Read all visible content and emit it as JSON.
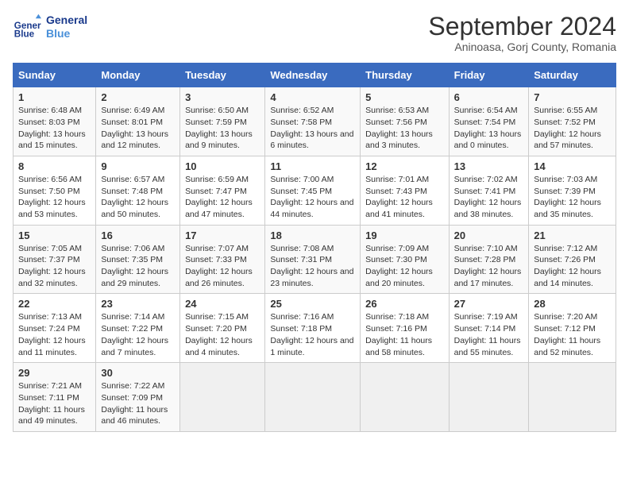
{
  "header": {
    "logo_line1": "General",
    "logo_line2": "Blue",
    "title": "September 2024",
    "subtitle": "Aninoasa, Gorj County, Romania"
  },
  "columns": [
    "Sunday",
    "Monday",
    "Tuesday",
    "Wednesday",
    "Thursday",
    "Friday",
    "Saturday"
  ],
  "weeks": [
    [
      {
        "day": "1",
        "sunrise": "6:48 AM",
        "sunset": "8:03 PM",
        "daylight": "13 hours and 15 minutes."
      },
      {
        "day": "2",
        "sunrise": "6:49 AM",
        "sunset": "8:01 PM",
        "daylight": "13 hours and 12 minutes."
      },
      {
        "day": "3",
        "sunrise": "6:50 AM",
        "sunset": "7:59 PM",
        "daylight": "13 hours and 9 minutes."
      },
      {
        "day": "4",
        "sunrise": "6:52 AM",
        "sunset": "7:58 PM",
        "daylight": "13 hours and 6 minutes."
      },
      {
        "day": "5",
        "sunrise": "6:53 AM",
        "sunset": "7:56 PM",
        "daylight": "13 hours and 3 minutes."
      },
      {
        "day": "6",
        "sunrise": "6:54 AM",
        "sunset": "7:54 PM",
        "daylight": "13 hours and 0 minutes."
      },
      {
        "day": "7",
        "sunrise": "6:55 AM",
        "sunset": "7:52 PM",
        "daylight": "12 hours and 57 minutes."
      }
    ],
    [
      {
        "day": "8",
        "sunrise": "6:56 AM",
        "sunset": "7:50 PM",
        "daylight": "12 hours and 53 minutes."
      },
      {
        "day": "9",
        "sunrise": "6:57 AM",
        "sunset": "7:48 PM",
        "daylight": "12 hours and 50 minutes."
      },
      {
        "day": "10",
        "sunrise": "6:59 AM",
        "sunset": "7:47 PM",
        "daylight": "12 hours and 47 minutes."
      },
      {
        "day": "11",
        "sunrise": "7:00 AM",
        "sunset": "7:45 PM",
        "daylight": "12 hours and 44 minutes."
      },
      {
        "day": "12",
        "sunrise": "7:01 AM",
        "sunset": "7:43 PM",
        "daylight": "12 hours and 41 minutes."
      },
      {
        "day": "13",
        "sunrise": "7:02 AM",
        "sunset": "7:41 PM",
        "daylight": "12 hours and 38 minutes."
      },
      {
        "day": "14",
        "sunrise": "7:03 AM",
        "sunset": "7:39 PM",
        "daylight": "12 hours and 35 minutes."
      }
    ],
    [
      {
        "day": "15",
        "sunrise": "7:05 AM",
        "sunset": "7:37 PM",
        "daylight": "12 hours and 32 minutes."
      },
      {
        "day": "16",
        "sunrise": "7:06 AM",
        "sunset": "7:35 PM",
        "daylight": "12 hours and 29 minutes."
      },
      {
        "day": "17",
        "sunrise": "7:07 AM",
        "sunset": "7:33 PM",
        "daylight": "12 hours and 26 minutes."
      },
      {
        "day": "18",
        "sunrise": "7:08 AM",
        "sunset": "7:31 PM",
        "daylight": "12 hours and 23 minutes."
      },
      {
        "day": "19",
        "sunrise": "7:09 AM",
        "sunset": "7:30 PM",
        "daylight": "12 hours and 20 minutes."
      },
      {
        "day": "20",
        "sunrise": "7:10 AM",
        "sunset": "7:28 PM",
        "daylight": "12 hours and 17 minutes."
      },
      {
        "day": "21",
        "sunrise": "7:12 AM",
        "sunset": "7:26 PM",
        "daylight": "12 hours and 14 minutes."
      }
    ],
    [
      {
        "day": "22",
        "sunrise": "7:13 AM",
        "sunset": "7:24 PM",
        "daylight": "12 hours and 11 minutes."
      },
      {
        "day": "23",
        "sunrise": "7:14 AM",
        "sunset": "7:22 PM",
        "daylight": "12 hours and 7 minutes."
      },
      {
        "day": "24",
        "sunrise": "7:15 AM",
        "sunset": "7:20 PM",
        "daylight": "12 hours and 4 minutes."
      },
      {
        "day": "25",
        "sunrise": "7:16 AM",
        "sunset": "7:18 PM",
        "daylight": "12 hours and 1 minute."
      },
      {
        "day": "26",
        "sunrise": "7:18 AM",
        "sunset": "7:16 PM",
        "daylight": "11 hours and 58 minutes."
      },
      {
        "day": "27",
        "sunrise": "7:19 AM",
        "sunset": "7:14 PM",
        "daylight": "11 hours and 55 minutes."
      },
      {
        "day": "28",
        "sunrise": "7:20 AM",
        "sunset": "7:12 PM",
        "daylight": "11 hours and 52 minutes."
      }
    ],
    [
      {
        "day": "29",
        "sunrise": "7:21 AM",
        "sunset": "7:11 PM",
        "daylight": "11 hours and 49 minutes."
      },
      {
        "day": "30",
        "sunrise": "7:22 AM",
        "sunset": "7:09 PM",
        "daylight": "11 hours and 46 minutes."
      },
      null,
      null,
      null,
      null,
      null
    ]
  ]
}
